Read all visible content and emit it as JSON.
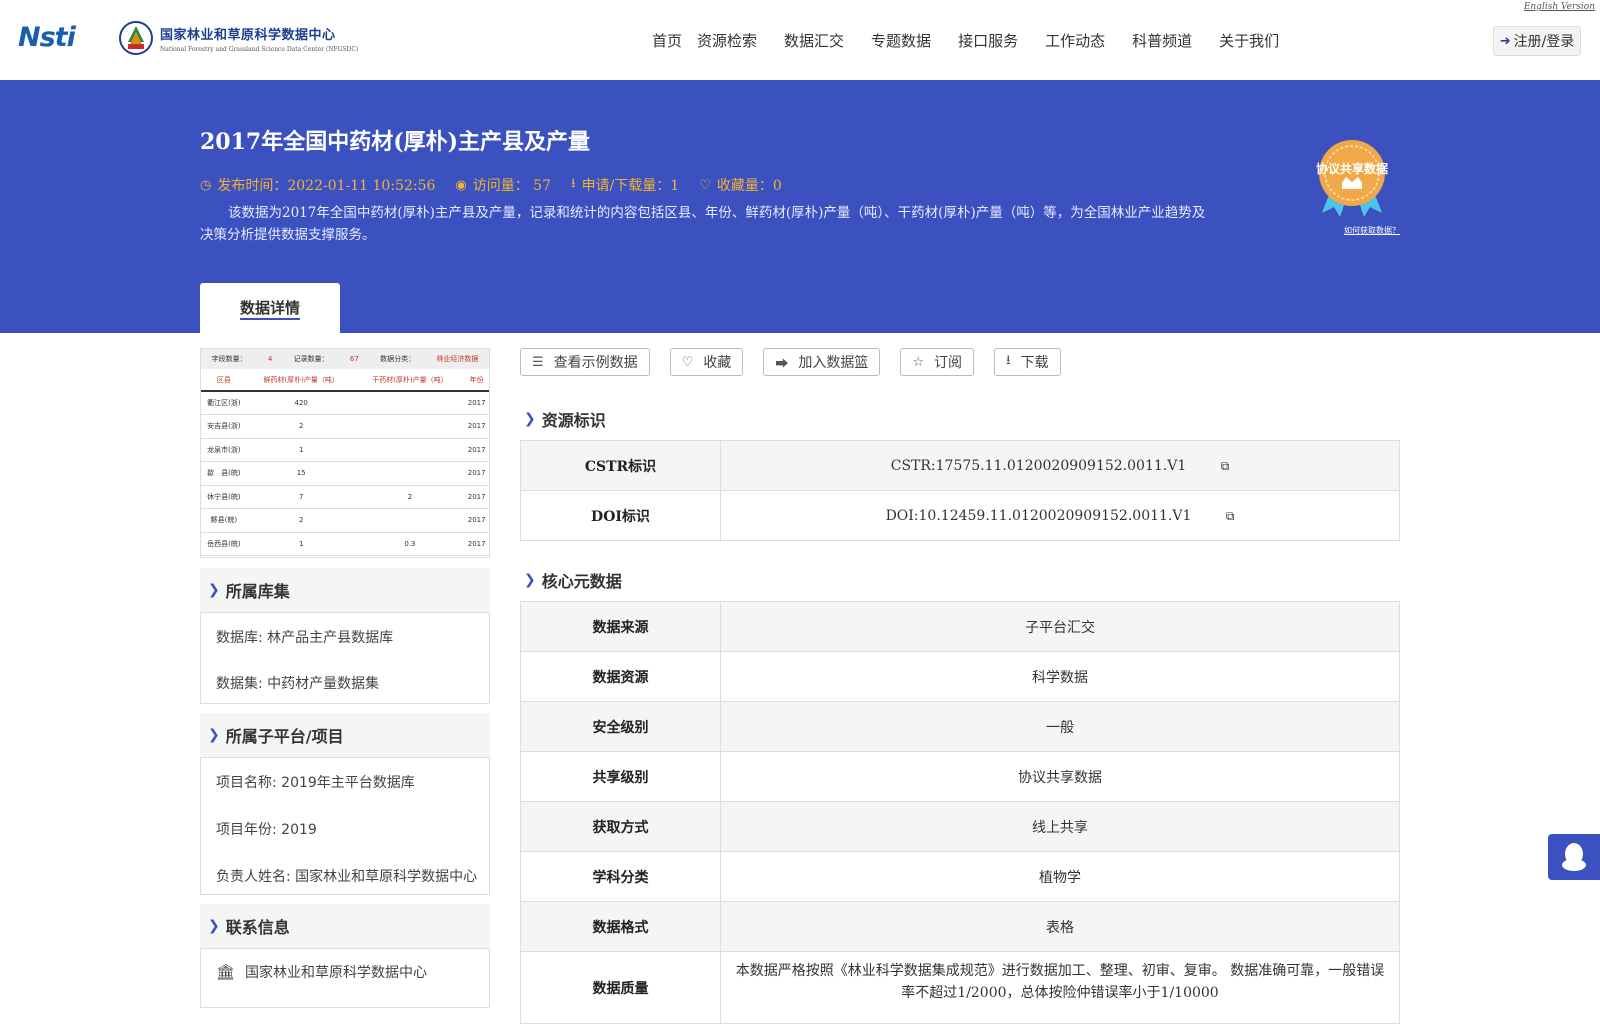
{
  "header": {
    "english_link": "English Version",
    "logo1_text": "Nsti",
    "logo2_title": "国家林业和草原科学数据中心",
    "logo2_subtitle": "National Forestry and Grassland Science Data Center (NFGSDC)",
    "nav": [
      "首页",
      "资源检索",
      "数据汇交",
      "专题数据",
      "接口服务",
      "工作动态",
      "科普频道",
      "关于我们"
    ],
    "login_label": "注册/登录"
  },
  "banner": {
    "title": "2017年全国中药材(厚朴)主产县及产量",
    "publish_time": "发布时间：2022-01-11 10:52:56",
    "views": "访问量： 57",
    "downloads": "申请/下载量：1",
    "favorites": "收藏量：0",
    "description": "该数据为2017年全国中药材(厚朴)主产县及产量，记录和统计的内容包括区县、年份、鲜药材(厚朴)产量（吨）、干药材(厚朴)产量（吨）等，为全国林业产业趋势及决策分析提供数据支撑服务。",
    "badge_text": "协议共享数据",
    "badge_link": "如何获取数据？",
    "tab_label": "数据详情"
  },
  "thumbnail": {
    "meta": [
      "字段数量：",
      "4",
      "记录数量：",
      "67",
      "数据分类：",
      "林业经济数据"
    ],
    "headers": [
      "区县",
      "鲜药材(厚朴)产量（吨）",
      "干药材(厚朴)产量（吨）",
      "年份"
    ],
    "rows": [
      [
        "衢江区(浙)",
        "420",
        "",
        "2017"
      ],
      [
        "安吉县(浙)",
        "2",
        "",
        "2017"
      ],
      [
        "龙泉市(浙)",
        "1",
        "",
        "2017"
      ],
      [
        "歙　县(皖)",
        "15",
        "",
        "2017"
      ],
      [
        "休宁县(皖)",
        "7",
        "2",
        "2017"
      ],
      [
        "黟县(皖)",
        "2",
        "",
        "2017"
      ],
      [
        "岳西县(皖)",
        "1",
        "0.3",
        "2017"
      ]
    ]
  },
  "left": {
    "library_title": "所属库集",
    "library_rows": [
      "数据库: 林产品主产县数据库",
      "数据集: 中药材产量数据集"
    ],
    "project_title": "所属子平台/项目",
    "project_rows": [
      "项目名称: 2019年主平台数据库",
      "项目年份: 2019",
      "负责人姓名: 国家林业和草原科学数据中心"
    ],
    "contact_title": "联系信息",
    "contact_org": "国家林业和草原科学数据中心"
  },
  "actions": [
    "查看示例数据",
    "收藏",
    "加入数据篮",
    "订阅",
    "下载"
  ],
  "resource_id": {
    "title": "资源标识",
    "rows": [
      {
        "k": "CSTR标识",
        "v": "CSTR:17575.11.0120020909152.0011.V1"
      },
      {
        "k": "DOI标识",
        "v": "DOI:10.12459.11.0120020909152.0011.V1"
      }
    ]
  },
  "core_meta": {
    "title": "核心元数据",
    "rows": [
      {
        "k": "数据来源",
        "v": "子平台汇交"
      },
      {
        "k": "数据资源",
        "v": "科学数据"
      },
      {
        "k": "安全级别",
        "v": "一般"
      },
      {
        "k": "共享级别",
        "v": "协议共享数据"
      },
      {
        "k": "获取方式",
        "v": "线上共享"
      },
      {
        "k": "学科分类",
        "v": "植物学"
      },
      {
        "k": "数据格式",
        "v": "表格"
      },
      {
        "k": "数据质量",
        "v": "本数据严格按照《林业科学数据集成规范》进行数据加工、整理、初审、复审。 数据准确可靠，一般错误率不超过1/2000，总体按险仲错误率小于1/10000"
      }
    ]
  }
}
